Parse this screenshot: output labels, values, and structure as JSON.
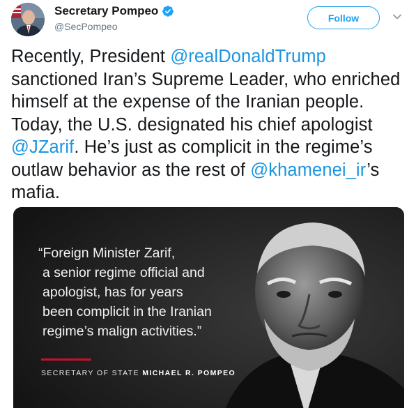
{
  "header": {
    "display_name": "Secretary Pompeo",
    "handle": "@SecPompeo",
    "follow_label": "Follow",
    "verified_icon": "verified-badge-icon",
    "caret_icon": "chevron-down-icon",
    "accent_color": "#1da1f2"
  },
  "tweet": {
    "segments": [
      {
        "type": "text",
        "text": "Recently, President "
      },
      {
        "type": "mention",
        "text": "@realDonaldTrump"
      },
      {
        "type": "text",
        "text": " sanctioned Iran’s Supreme Leader, who enriched himself at the expense of the Iranian people. Today, the U.S. designated his chief apologist "
      },
      {
        "type": "mention",
        "text": "@JZarif"
      },
      {
        "type": "text",
        "text": ". He’s just as complicit in the regime’s outlaw behavior as the rest of "
      },
      {
        "type": "mention",
        "text": "@khamenei_ir"
      },
      {
        "type": "text",
        "text": "’s mafia."
      }
    ]
  },
  "media": {
    "quote_lines": [
      "“Foreign Minister Zarif,",
      "a senior regime official and",
      "apologist, has for years",
      "been complicit in the Iranian",
      "regime’s malign activities.”"
    ],
    "attribution_prefix": "SECRETARY OF STATE",
    "attribution_name": "MICHAEL R. POMPEO",
    "rule_color": "#c8102e"
  }
}
